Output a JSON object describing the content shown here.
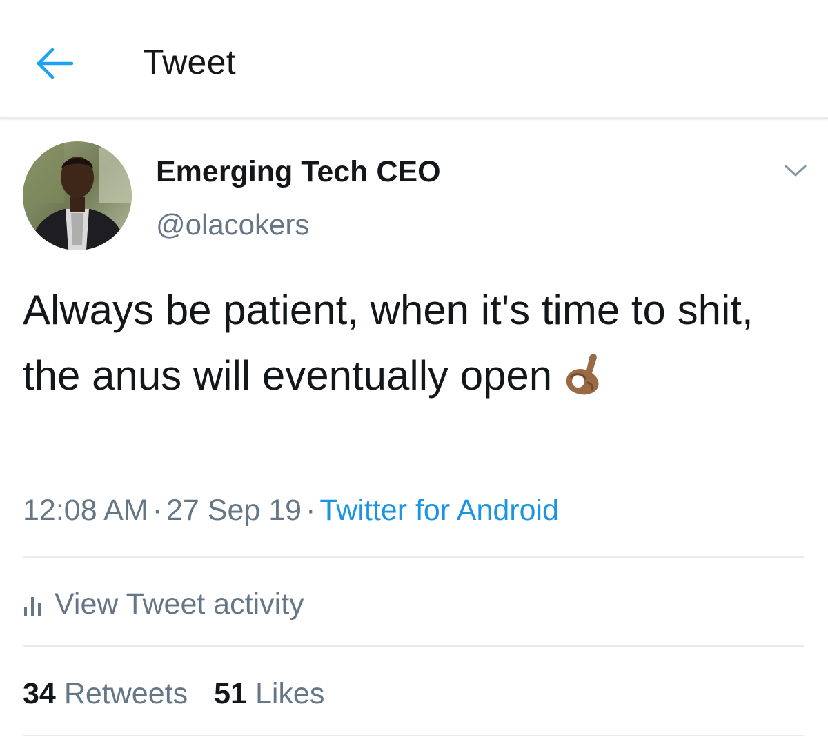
{
  "header": {
    "back_icon": "arrow-left-icon",
    "title": "Tweet"
  },
  "tweet": {
    "author": {
      "display_name": "Emerging Tech CEO",
      "handle": "@olacokers",
      "avatar_icon": "avatar-photo"
    },
    "more_icon": "chevron-down-icon",
    "text": "Always be patient, when it's time to shit, the anus will eventually open",
    "emoji": "ok-hand-medium-dark-skin-emoji",
    "time": "12:08 AM",
    "date": "27 Sep 19",
    "separator": "·",
    "source": "Twitter for Android",
    "activity_label": "View Tweet activity",
    "activity_icon": "bar-chart-icon",
    "stats": {
      "retweets_count": "34",
      "retweets_label": "Retweets",
      "likes_count": "51",
      "likes_label": "Likes"
    }
  },
  "colors": {
    "accent": "#1b95e0",
    "secondary_text": "#657786",
    "primary_text": "#14171a",
    "divider": "#e6ecf0",
    "emoji_skin": "#9a6a44"
  }
}
